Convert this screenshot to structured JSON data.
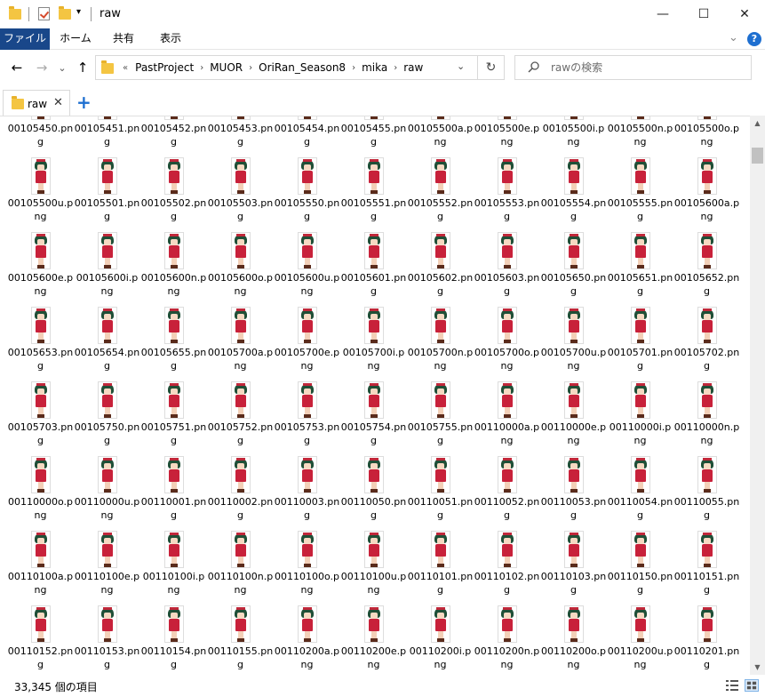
{
  "window": {
    "title": "raw",
    "minimize": "—",
    "maximize": "☐",
    "close": "✕"
  },
  "ribbon": {
    "tabs": [
      "ファイル",
      "ホーム",
      "共有",
      "表示"
    ],
    "expand": "⌄",
    "help": "?"
  },
  "nav": {
    "back": "←",
    "forward": "→",
    "recent": "⌄",
    "up": "↑",
    "overflow": "«",
    "breadcrumbs": [
      "PastProject",
      "MUOR",
      "OriRan_Season8",
      "mika",
      "raw"
    ],
    "sep": "›",
    "dropdown": "⌄",
    "refresh": "↻",
    "search_placeholder": "rawの検索"
  },
  "tabs": {
    "label": "raw",
    "close": "✕",
    "add": "+"
  },
  "files": [
    "00105450.png",
    "00105451.png",
    "00105452.png",
    "00105453.png",
    "00105454.png",
    "00105455.png",
    "00105500a.png",
    "00105500e.png",
    "00105500i.png",
    "00105500n.png",
    "00105500o.png",
    "00105500u.png",
    "00105501.png",
    "00105502.png",
    "00105503.png",
    "00105550.png",
    "00105551.png",
    "00105552.png",
    "00105553.png",
    "00105554.png",
    "00105555.png",
    "00105600a.png",
    "00105600e.png",
    "00105600i.png",
    "00105600n.png",
    "00105600o.png",
    "00105600u.png",
    "00105601.png",
    "00105602.png",
    "00105603.png",
    "00105650.png",
    "00105651.png",
    "00105652.png",
    "00105653.png",
    "00105654.png",
    "00105655.png",
    "00105700a.png",
    "00105700e.png",
    "00105700i.png",
    "00105700n.png",
    "00105700o.png",
    "00105700u.png",
    "00105701.png",
    "00105702.png",
    "00105703.png",
    "00105750.png",
    "00105751.png",
    "00105752.png",
    "00105753.png",
    "00105754.png",
    "00105755.png",
    "00110000a.png",
    "00110000e.png",
    "00110000i.png",
    "00110000n.png",
    "00110000o.png",
    "00110000u.png",
    "00110001.png",
    "00110002.png",
    "00110003.png",
    "00110050.png",
    "00110051.png",
    "00110052.png",
    "00110053.png",
    "00110054.png",
    "00110055.png",
    "00110100a.png",
    "00110100e.png",
    "00110100i.png",
    "00110100n.png",
    "00110100o.png",
    "00110100u.png",
    "00110101.png",
    "00110102.png",
    "00110103.png",
    "00110150.png",
    "00110151.png",
    "00110152.png",
    "00110153.png",
    "00110154.png",
    "00110155.png",
    "00110200a.png",
    "00110200e.png",
    "00110200i.png",
    "00110200n.png",
    "00110200o.png",
    "00110200u.png",
    "00110201.png"
  ],
  "status": {
    "count": "33,345 個の項目"
  },
  "colors": {
    "file_tab": "#19478a",
    "accent": "#1e6fd0",
    "folder": "#f4c542"
  }
}
